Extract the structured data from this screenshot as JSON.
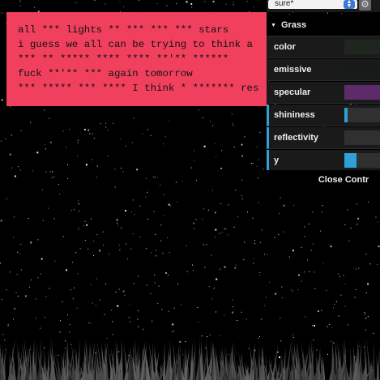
{
  "note": {
    "lines": [
      "all *** lights ** *** *** *** stars",
      "i guess we all can be trying to think a",
      "*** ** ***** **** **** **'** ******",
      "fuck **'** *** again tomorrow",
      "*** ***** *** **** I think * ******* res"
    ]
  },
  "gui": {
    "preset_value": "sure*",
    "gear_icon": "gear-icon",
    "folder": {
      "title": "Grass",
      "controls": [
        {
          "label": "color",
          "kind": "color",
          "value": "#1f2620"
        },
        {
          "label": "emissive",
          "kind": "color",
          "value": "#161a18"
        },
        {
          "label": "specular",
          "kind": "color",
          "value": "#5d2a6a"
        },
        {
          "label": "shininess",
          "kind": "number",
          "fraction": 0.05
        },
        {
          "label": "reflectivity",
          "kind": "number",
          "fraction": 0.0
        },
        {
          "label": "y",
          "kind": "number",
          "fraction": 0.25
        }
      ]
    },
    "close_label": "Close Contr",
    "accent": "#2fa1d6"
  },
  "colors": {
    "note_background": "#f0405e",
    "sky": "#000000",
    "grass": "#4a4a4a"
  }
}
